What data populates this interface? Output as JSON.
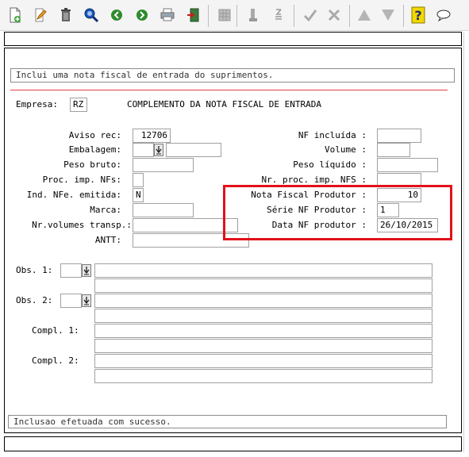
{
  "toolbar": {
    "icons": [
      "new-document-icon",
      "edit-pencil-icon",
      "delete-trash-icon",
      "search-binoculars-icon",
      "back-arrow-icon",
      "forward-arrow-icon",
      "print-icon",
      "exit-icon",
      "grid-icon",
      "import-icon",
      "order-icon",
      "confirm-check-icon",
      "cancel-x-icon",
      "up-triangle-icon",
      "down-triangle-icon",
      "help-question-icon",
      "chat-balloon-icon"
    ],
    "accent": "#2e8b2e",
    "help_color": "#f2d700"
  },
  "header_message": "Inclui uma nota fiscal de entrada do suprimentos.",
  "empresa": {
    "label": "Empresa:",
    "value": "RZ",
    "title": "COMPLEMENTO DA NOTA FISCAL DE ENTRADA"
  },
  "left_fields": {
    "aviso_rec": {
      "label": "Aviso rec:",
      "value": "12706"
    },
    "embalagem": {
      "label": "Embalagem:",
      "value": "",
      "value2": ""
    },
    "peso_bruto": {
      "label": "Peso bruto:",
      "value": ""
    },
    "proc_imp_nfs": {
      "label": "Proc. imp. NFs:",
      "value": ""
    },
    "ind_nfe": {
      "label": "Ind. NFe. emitida:",
      "value": "N"
    },
    "marca": {
      "label": "Marca:",
      "value": ""
    },
    "nr_volumes": {
      "label": "Nr.volumes transp.:",
      "value": ""
    },
    "antt": {
      "label": "ANTT:",
      "value": ""
    }
  },
  "right_fields": {
    "nf_incluida": {
      "label": "NF incluída :",
      "value": ""
    },
    "volume": {
      "label": "Volume :",
      "value": ""
    },
    "peso_liquido": {
      "label": "Peso líquido :",
      "value": ""
    },
    "nr_proc_nfs": {
      "label": "Nr. proc. imp. NFS :",
      "value": ""
    },
    "nota_fiscal_produtor": {
      "label": "Nota Fiscal Produtor :",
      "value": "10"
    },
    "serie_nf_produtor": {
      "label": "Série NF Produtor :",
      "value": "1"
    },
    "data_nf_produtor": {
      "label": "Data NF produtor :",
      "value": "26/10/2015"
    }
  },
  "highlight_color": "#e3101a",
  "obs": {
    "obs1": {
      "label": "Obs. 1:",
      "code": "",
      "line1": "",
      "line2": ""
    },
    "obs2": {
      "label": "Obs. 2:",
      "code": "",
      "line1": "",
      "line2": ""
    },
    "compl1": {
      "label": "Compl. 1:",
      "line1": "",
      "line2": ""
    },
    "compl2": {
      "label": "Compl. 2:",
      "line1": "",
      "line2": ""
    }
  },
  "status_message": "Inclusao efetuada com sucesso."
}
